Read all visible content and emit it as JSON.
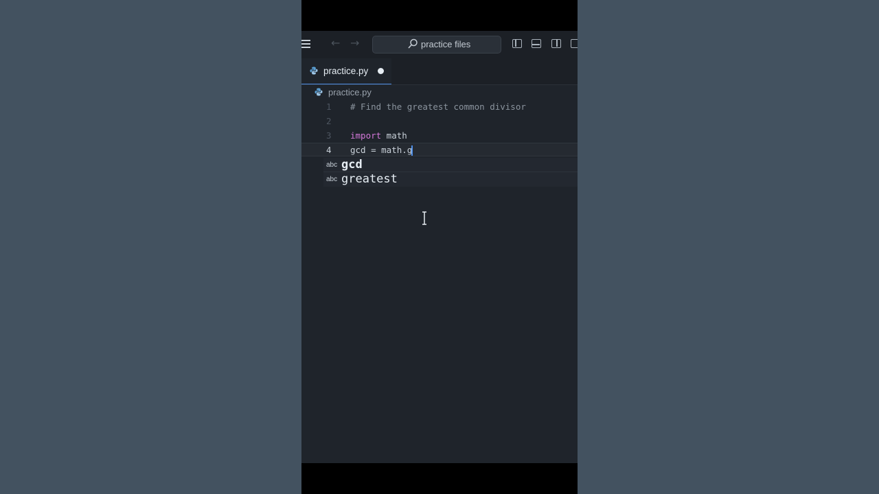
{
  "titlebar": {
    "search_label": "practice files"
  },
  "tabs": [
    {
      "label": "practice.py",
      "modified": true
    }
  ],
  "breadcrumb": {
    "file": "practice.py"
  },
  "editor": {
    "active_line": 4,
    "lines": [
      {
        "number": "1",
        "parts": [
          {
            "text": "# Find the greatest common divisor",
            "kind": "comment"
          }
        ]
      },
      {
        "number": "2",
        "parts": []
      },
      {
        "number": "3",
        "parts": [
          {
            "text": "import",
            "kind": "keyword"
          },
          {
            "text": " math",
            "kind": "plain"
          }
        ]
      },
      {
        "number": "4",
        "parts": [
          {
            "text": "gcd = math.g",
            "kind": "plain"
          }
        ]
      }
    ]
  },
  "suggestions": [
    {
      "kind": "abc",
      "text": "gcd"
    },
    {
      "kind": "abc",
      "text": "greatest"
    }
  ],
  "colors": {
    "accent": "#4f8fe8",
    "keyword": "#d378d9",
    "comment": "#8b949e",
    "background": "#1f242b"
  },
  "icons": {
    "menu": "hamburger-icon",
    "back": "arrow-left-icon",
    "forward": "arrow-right-icon",
    "search": "search-icon",
    "file": "python-file-icon"
  }
}
